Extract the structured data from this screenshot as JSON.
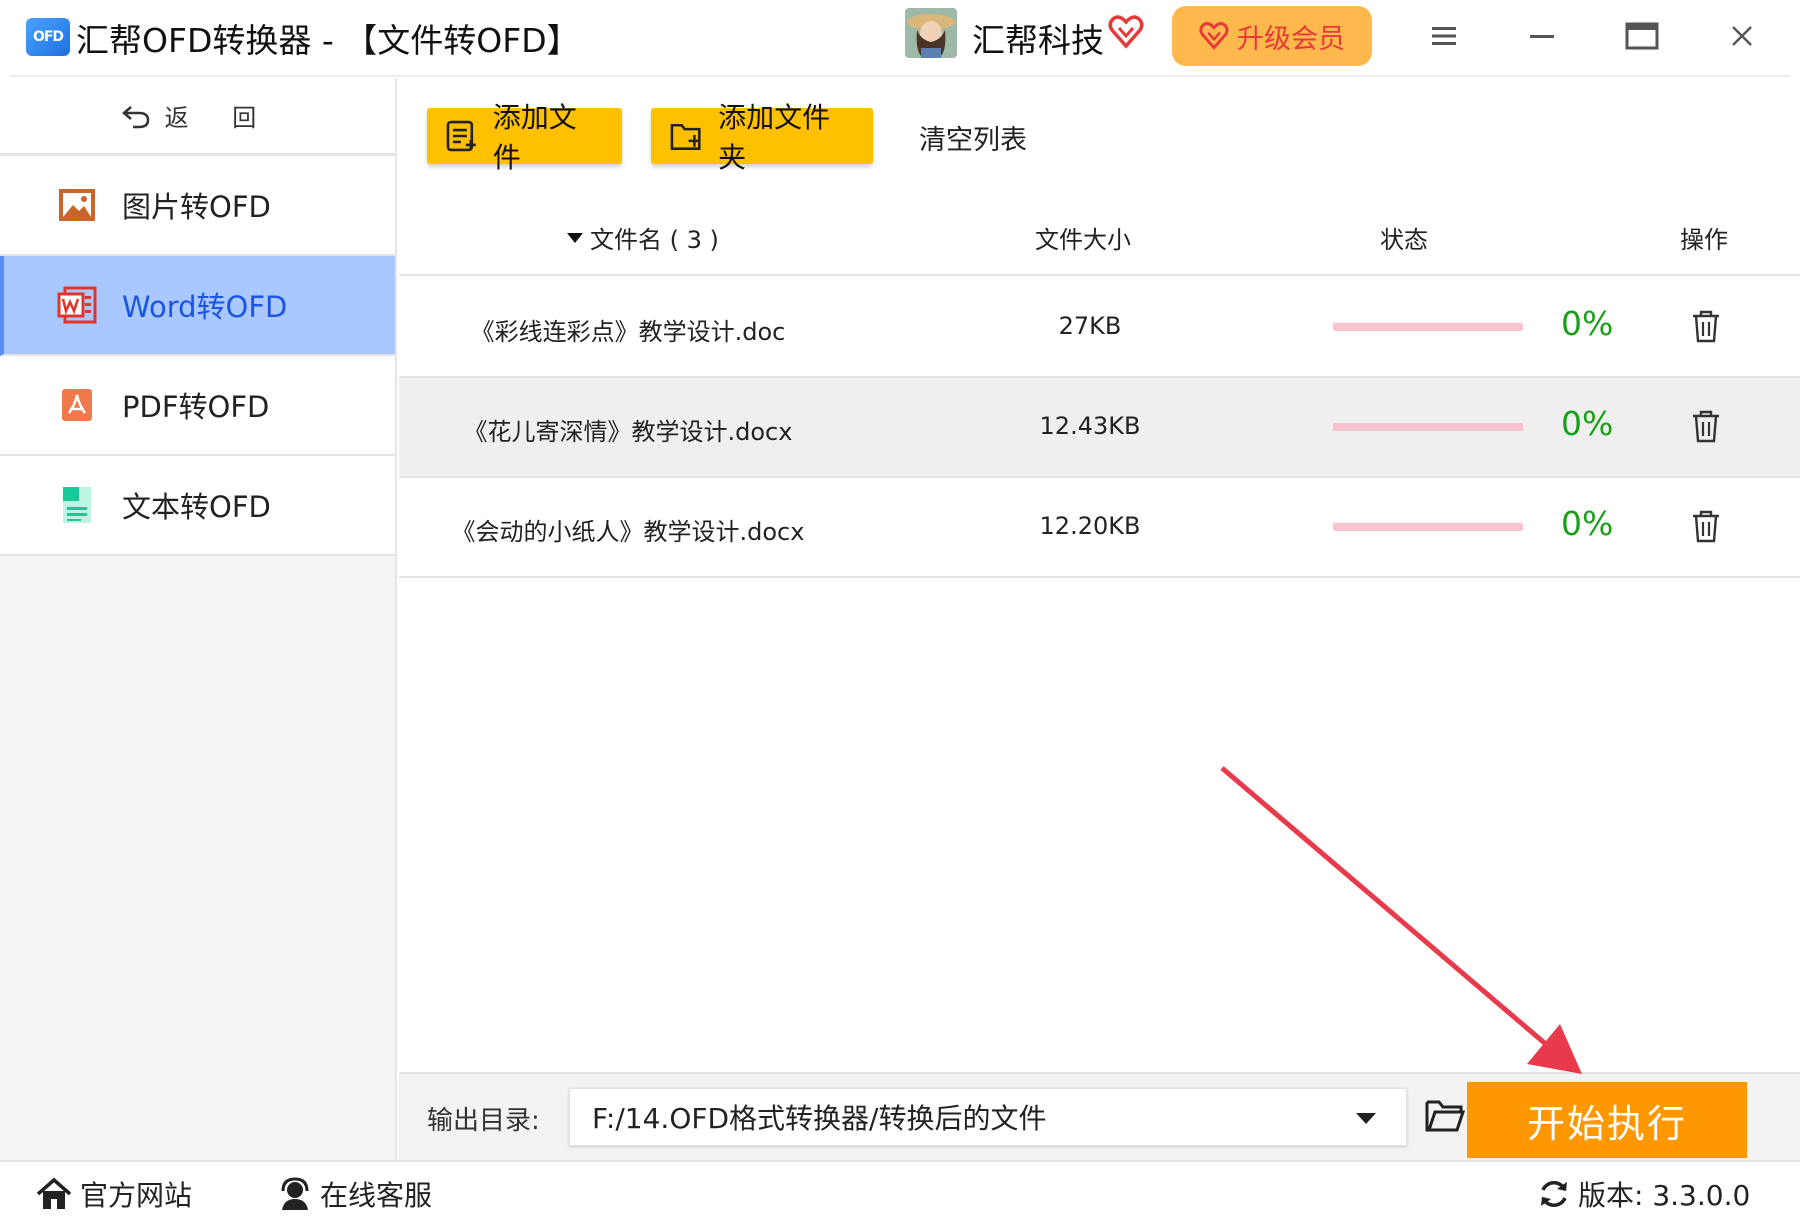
{
  "titlebar": {
    "logo_text": "OFD",
    "app_title": "汇帮OFD转换器 - 【文件转OFD】",
    "company": "汇帮科技",
    "upgrade_label": "升级会员",
    "icons": [
      "menu-icon",
      "minimize-icon",
      "maximize-icon",
      "close-icon"
    ]
  },
  "sidebar": {
    "back_label": "返 回",
    "items": [
      {
        "label": "图片转OFD",
        "icon": "image-icon",
        "active": false
      },
      {
        "label": "Word转OFD",
        "icon": "word-icon",
        "active": true
      },
      {
        "label": "PDF转OFD",
        "icon": "pdf-icon",
        "active": false
      },
      {
        "label": "文本转OFD",
        "icon": "text-file-icon",
        "active": false
      }
    ]
  },
  "toolbar": {
    "add_file": "添加文件",
    "add_folder": "添加文件夹",
    "clear_list": "清空列表"
  },
  "table": {
    "headers": {
      "name": "文件名 ( 3 )",
      "size": "文件大小",
      "status": "状态",
      "action": "操作"
    },
    "rows": [
      {
        "name": "《彩线连彩点》教学设计.doc",
        "size": "27KB",
        "progress": 0,
        "percent": "0%"
      },
      {
        "name": "《花儿寄深情》教学设计.docx",
        "size": "12.43KB",
        "progress": 0,
        "percent": "0%"
      },
      {
        "name": "《会动的小纸人》教学设计.docx",
        "size": "12.20KB",
        "progress": 0,
        "percent": "0%"
      }
    ]
  },
  "output": {
    "label": "输出目录:",
    "path": "F:/14.OFD格式转换器/转换后的文件",
    "start_label": "开始执行"
  },
  "statusbar": {
    "website": "官方网站",
    "support": "在线客服",
    "version": "版本: 3.3.0.0"
  },
  "colors": {
    "accent_yellow": "#ffc000",
    "start_orange": "#ff9800",
    "active_nav_bg": "#a9c8ff",
    "percent_green": "#19a019",
    "annotation_red": "#e83a4a"
  }
}
